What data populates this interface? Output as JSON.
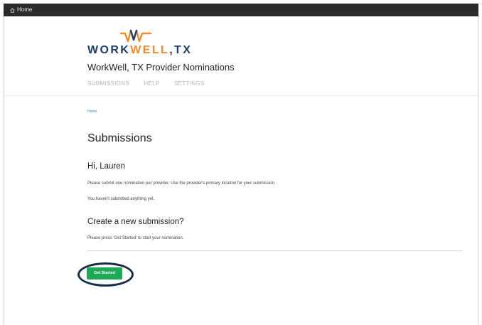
{
  "topbar": {
    "home_label": "Home"
  },
  "logo": {
    "part1": "WORK",
    "part2": "WELL",
    "part3": ",TX"
  },
  "site_title": "WorkWell, TX Provider Nominations",
  "nav": [
    "SUBMISSIONS",
    "HELP",
    "SETTINGS"
  ],
  "breadcrumb": "Home",
  "page_title": "Submissions",
  "greeting": "Hi, Lauren",
  "intro_text": "Please submit one nomination per provider. Use the provider's primary location for your submission.",
  "status_text": "You haven't submitted anything yet.",
  "create_heading": "Create a new submission?",
  "create_text": "Please press 'Get Started' to start your nomination.",
  "get_started_label": "Get Started",
  "colors": {
    "brand_navy": "#1d3f67",
    "brand_orange": "#f08a2c",
    "button_green": "#1fa957",
    "highlight_ring": "#162c47"
  },
  "icons": {
    "home": "home-icon",
    "logo": "heartbeat-logo-icon"
  }
}
